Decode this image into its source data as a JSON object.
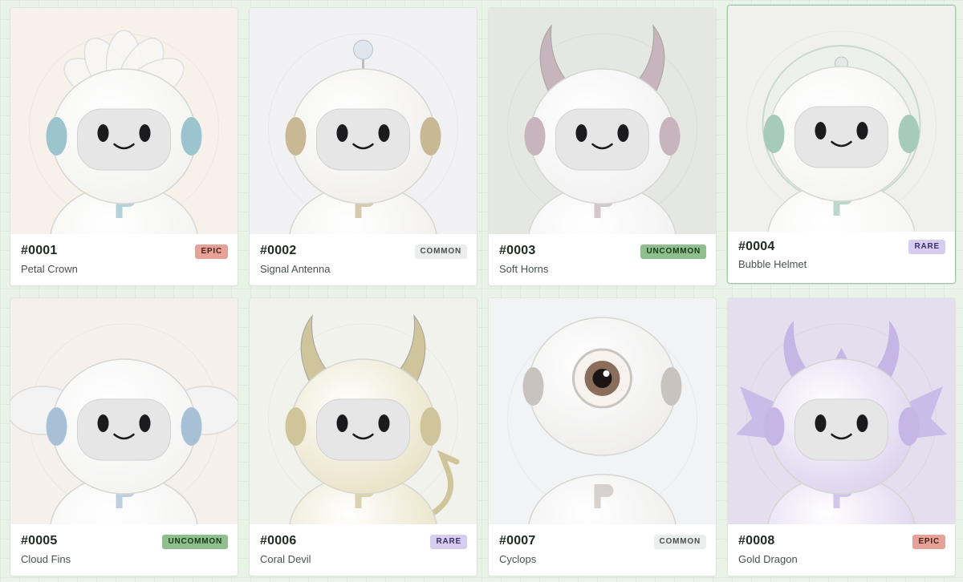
{
  "cards": [
    {
      "number": "#0001",
      "name": "Petal Crown",
      "rarity": "EPIC",
      "rarity_class": "epic",
      "bg": "#f8f1ea",
      "body": "#f2f2f0",
      "accent": "#9cc4cf",
      "feature": "petal-crown",
      "selected": false
    },
    {
      "number": "#0002",
      "name": "Signal Antenna",
      "rarity": "COMMON",
      "rarity_class": "common",
      "bg": "#f1f1f3",
      "body": "#f0efec",
      "accent": "#c9b894",
      "feature": "antenna",
      "selected": false
    },
    {
      "number": "#0003",
      "name": "Soft Horns",
      "rarity": "UNCOMMON",
      "rarity_class": "uncommon",
      "bg": "#e5e7e3",
      "body": "#f1f1f1",
      "accent": "#c7b4bd",
      "feature": "horns",
      "selected": false
    },
    {
      "number": "#0004",
      "name": "Bubble Helmet",
      "rarity": "RARE",
      "rarity_class": "rare",
      "bg": "#f0f1ee",
      "body": "#f4f4f2",
      "accent": "#a6cbbd",
      "feature": "bubble",
      "selected": true
    },
    {
      "number": "#0005",
      "name": "Cloud Fins",
      "rarity": "UNCOMMON",
      "rarity_class": "uncommon",
      "bg": "#f6f0ec",
      "body": "#f3f3f2",
      "accent": "#a8c0d6",
      "feature": "fins",
      "selected": false
    },
    {
      "number": "#0006",
      "name": "Coral Devil",
      "rarity": "RARE",
      "rarity_class": "rare",
      "bg": "#f2f2ed",
      "body": "#e8e2c4",
      "accent": "#cfc49a",
      "feature": "devil",
      "selected": false
    },
    {
      "number": "#0007",
      "name": "Cyclops",
      "rarity": "COMMON",
      "rarity_class": "common",
      "bg": "#f2f3f4",
      "body": "#eeedec",
      "accent": "#c8c3bf",
      "feature": "cyclops",
      "selected": false
    },
    {
      "number": "#0008",
      "name": "Gold Dragon",
      "rarity": "EPIC",
      "rarity_class": "epic",
      "bg": "#e4deee",
      "body": "#ddd2ee",
      "accent": "#c5b6e6",
      "feature": "dragon",
      "selected": false
    }
  ]
}
